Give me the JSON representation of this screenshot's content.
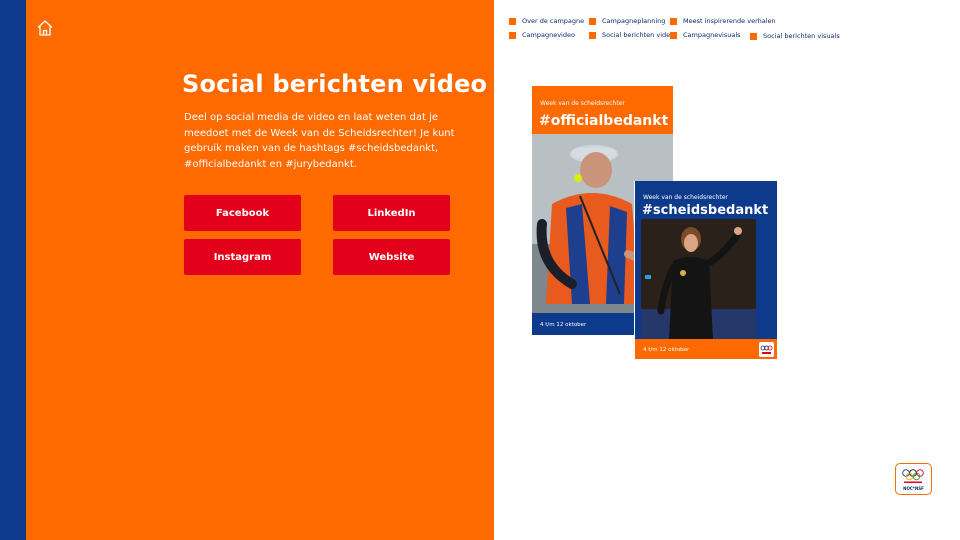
{
  "nav": {
    "items": [
      {
        "label": "Over de campagne"
      },
      {
        "label": "Campagneplanning"
      },
      {
        "label": "Meest inspirerende verhalen"
      },
      {
        "label": "Campagnevideo"
      },
      {
        "label": "Social berichten video"
      },
      {
        "label": "Campagnevisuals"
      },
      {
        "label": "Social berichten visuals"
      }
    ]
  },
  "page": {
    "title": "Social berichten video",
    "description": "Deel op social media de video en laat weten dat je meedoet met de Week van de Scheidsrechter! Je kunt gebruik maken van de hashtags #scheidsbedankt, #officialbedankt en #jurybedankt."
  },
  "buttons": {
    "facebook": "Facebook",
    "linkedin": "LinkedIn",
    "instagram": "Instagram",
    "website": "Website"
  },
  "visual1": {
    "subtitle": "Week van de scheidsrechter",
    "hashtag": "#officialbedankt",
    "date": "4 t/m 12 oktober"
  },
  "visual2": {
    "subtitle": "Week van de scheidsrechter",
    "hashtag": "#scheidsbedankt",
    "date": "4 t/m 12 oktober"
  },
  "logo": {
    "text": "NOC*NSF"
  },
  "colors": {
    "orange": "#ff6a00",
    "blue": "#0e3a8c",
    "red": "#e3001b"
  },
  "icons": {
    "home": "home-icon"
  }
}
